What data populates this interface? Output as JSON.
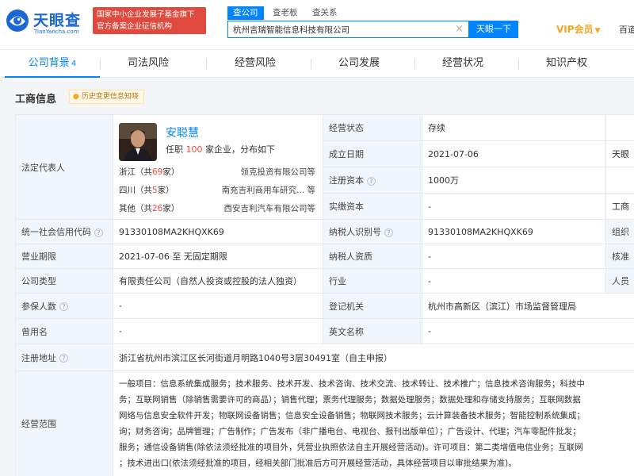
{
  "header": {
    "logo_text": "天眼查",
    "logo_sub": "TianYancha.com",
    "gov_badge": [
      "国家中小企业发展子基金旗下",
      "官方备案企业征信机构"
    ],
    "search_tabs": [
      "查公司",
      "查老板",
      "查关系"
    ],
    "search_value": "杭州吉瑞智能信息科技有限公司",
    "search_button": "天眼一下",
    "vip_label": "VIP会员",
    "more_label": "百道"
  },
  "nav": {
    "tabs": [
      {
        "label": "公司背景",
        "count": "4"
      },
      {
        "label": "司法风险",
        "count": ""
      },
      {
        "label": "经营风险",
        "count": ""
      },
      {
        "label": "公司发展",
        "count": ""
      },
      {
        "label": "经营状况",
        "count": ""
      },
      {
        "label": "知识产权",
        "count": ""
      }
    ]
  },
  "section": {
    "title": "工商信息",
    "history_tag": "历史变更信息知晓"
  },
  "legal_rep": {
    "label": "法定代表人",
    "name": "安聪慧",
    "tenure_prefix": "任职",
    "tenure_count": "100",
    "tenure_suffix": "家企业，分布如下",
    "regions": [
      {
        "name": "浙江（共",
        "count": "69",
        "unit": "家）",
        "corp": "领克投资有限公司等"
      },
      {
        "name": "四川（共",
        "count": "5",
        "unit": "家）",
        "corp": "南充吉利商用车研究...  等"
      },
      {
        "name": "其他（共",
        "count": "26",
        "unit": "家）",
        "corp": "西安吉利汽车有限公司等"
      }
    ]
  },
  "rows": {
    "status_label": "经营状态",
    "status_value": "存续",
    "founded_label": "成立日期",
    "founded_value": "2021-07-06",
    "founded_extra": "天眼",
    "capital_label": "注册资本",
    "capital_value": "1000万",
    "paid_label": "实缴资本",
    "paid_value": "-",
    "paid_extra": "工商",
    "credit_label": "统一社会信用代码",
    "credit_value": "91330108MA2KHQXK69",
    "taxid_label": "纳税人识别号",
    "taxid_value": "91330108MA2KHQXK69",
    "taxid_extra": "组织",
    "term_label": "营业期限",
    "term_value": "2021-07-06 至 无固定期限",
    "taxq_label": "纳税人资质",
    "taxq_value": "-",
    "taxq_extra": "核准",
    "type_label": "公司类型",
    "type_value": "有限责任公司（自然人投资或控股的法人独资）",
    "industry_label": "行业",
    "industry_value": "-",
    "industry_extra": "人员",
    "insured_label": "参保人数",
    "insured_value": "-",
    "authority_label": "登记机关",
    "authority_value": "杭州市高新区（滨江）市场监督管理局",
    "former_label": "曾用名",
    "former_value": "-",
    "english_label": "英文名称",
    "english_value": "-",
    "address_label": "注册地址",
    "address_value": "浙江省杭州市滨江区长河街道月明路1040号3层30491室（自主申报）",
    "scope_label": "经营范围",
    "scope_lines": [
      "一般项目：信息系统集成服务；技术服务、技术开发、技术咨询、技术交流、技术转让、技术推广；信息技术咨询服务；科技中",
      "务；互联网销售（除销售需要许可的商品）；销售代理；票务代理服务；数据处理服务；数据处理和存储支持服务；互联网数据",
      "网络与信息安全软件开发；物联网设备销售；信息安全设备销售；物联网技术服务；云计算装备技术服务；智能控制系统集成；",
      "询；财务咨询；品牌管理；广告制作；广告发布（非广播电台、电视台、报刊出版单位）；广告设计、代理；汽车零配件批发；",
      "服务；通信设备销售(除依法须经批准的项目外，凭营业执照依法自主开展经营活动)。许可项目：第二类增值电信业务；互联网",
      "；技术进出口(依法须经批准的项目，经相关部门批准后方可开展经营活动，具体经营项目以审批结果为准)。"
    ]
  }
}
